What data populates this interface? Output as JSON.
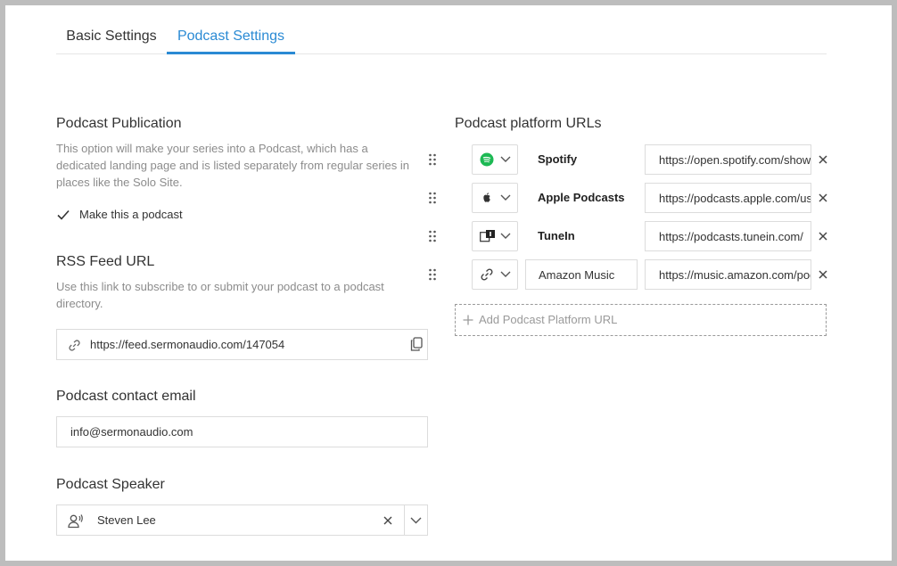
{
  "tabs": [
    {
      "label": "Basic Settings",
      "active": false
    },
    {
      "label": "Podcast Settings",
      "active": true
    }
  ],
  "colors": {
    "accent": "#2a8ad4",
    "spotify": "#1db954"
  },
  "publication": {
    "title": "Podcast Publication",
    "help": "This option will make your series into a Podcast, which has a dedicated landing page and is listed separately from regular series in places like the Solo Site.",
    "checkbox_label": "Make this a podcast",
    "checked": true
  },
  "rss": {
    "title": "RSS Feed URL",
    "help": "Use this link to subscribe to or submit your podcast to a podcast directory.",
    "url": "https://feed.sermonaudio.com/147054"
  },
  "contact": {
    "title": "Podcast contact email",
    "email": "info@sermonaudio.com"
  },
  "speaker": {
    "title": "Podcast Speaker",
    "value": "Steven Lee"
  },
  "platforms": {
    "title": "Podcast platform URLs",
    "rows": [
      {
        "icon": "spotify-icon",
        "name": "Spotify",
        "url": "https://open.spotify.com/show/"
      },
      {
        "icon": "apple-icon",
        "name": "Apple Podcasts",
        "url": "https://podcasts.apple.com/us/"
      },
      {
        "icon": "tunein-icon",
        "name": "TuneIn",
        "url": "https://podcasts.tunein.com/"
      },
      {
        "icon": "link-icon",
        "name": "Amazon Music",
        "url": "https://music.amazon.com/podcasts/"
      }
    ],
    "add_label": "Add Podcast Platform URL"
  }
}
